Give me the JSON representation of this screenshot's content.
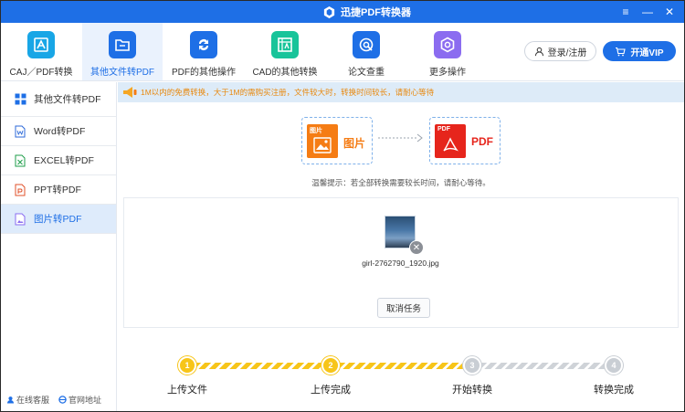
{
  "window": {
    "title": "迅捷PDF转换器",
    "controls": [
      "≡",
      "—",
      "✕"
    ]
  },
  "toolbar": {
    "items": [
      {
        "label": "CAJ／PDF转换",
        "icon": "caj-convert-icon",
        "color": "#18a6e6"
      },
      {
        "label": "其他文件转PDF",
        "icon": "folder-icon",
        "color": "#1e6fe6"
      },
      {
        "label": "PDF的其他操作",
        "icon": "refresh-icon",
        "color": "#1e6fe6"
      },
      {
        "label": "CAD的其他转换",
        "icon": "cad-icon",
        "color": "#18c49a"
      },
      {
        "label": "论文查重",
        "icon": "check-icon",
        "color": "#1e6fe6"
      },
      {
        "label": "更多操作",
        "icon": "gear-icon",
        "color": "#8b6cf0"
      }
    ],
    "active_index": 1,
    "login_label": "登录/注册",
    "vip_label": "开通VIP"
  },
  "sidebar": {
    "items": [
      {
        "label": "其他文件转PDF",
        "icon": "grid-icon"
      },
      {
        "label": "Word转PDF",
        "icon": "word-doc-icon"
      },
      {
        "label": "EXCEL转PDF",
        "icon": "excel-doc-icon"
      },
      {
        "label": "PPT转PDF",
        "icon": "ppt-doc-icon"
      },
      {
        "label": "图片转PDF",
        "icon": "image-doc-icon"
      }
    ],
    "active_index": 4,
    "footer": {
      "service": "在线客服",
      "website": "官网地址"
    }
  },
  "banner": {
    "text": "1M以内的免费转换，大于1M的需购买注册，文件较大时，转换时间较长，请耐心等待"
  },
  "conversion": {
    "source_tag": "图片",
    "source_name": "图片",
    "target_tag": "PDF",
    "target_name": "PDF",
    "source_color": "#f57c14",
    "target_color": "#e6251c"
  },
  "hint": "温馨提示：若全部转换需要较长时间，请耐心等待。",
  "file": {
    "name": "girl-2762790_1920.jpg",
    "cancel_label": "取消任务"
  },
  "steps": [
    {
      "num": "1",
      "label": "上传文件",
      "done": true
    },
    {
      "num": "2",
      "label": "上传完成",
      "done": true
    },
    {
      "num": "3",
      "label": "开始转换",
      "done": false
    },
    {
      "num": "4",
      "label": "转换完成",
      "done": false
    }
  ]
}
